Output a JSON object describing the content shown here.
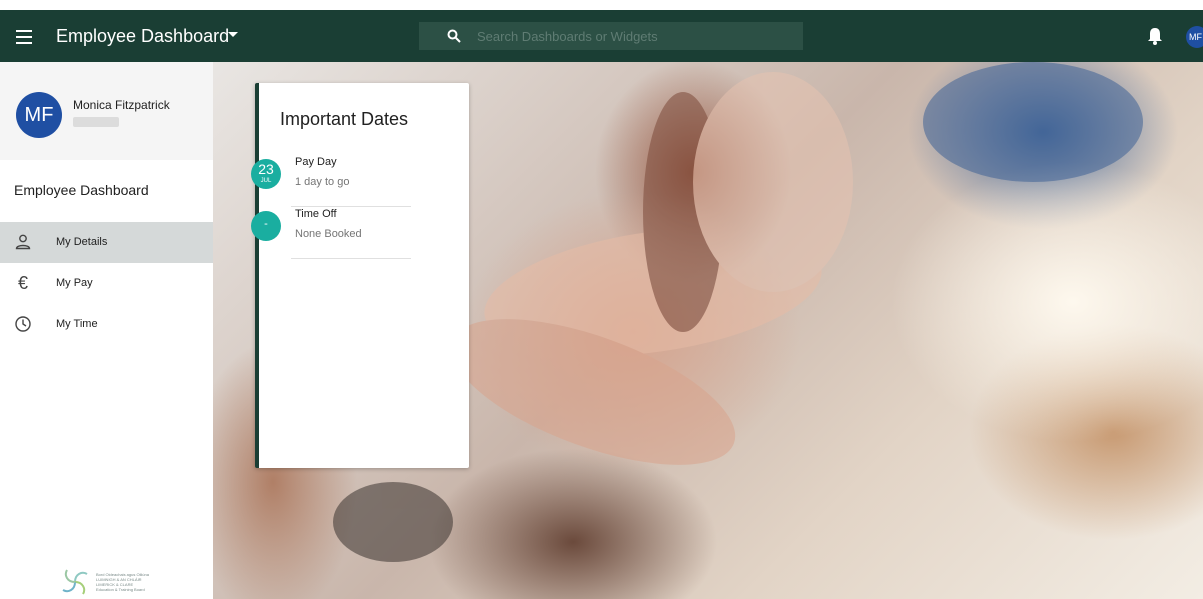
{
  "header": {
    "title": "Employee Dashboard",
    "search_placeholder": "Search Dashboards or Widgets",
    "avatar_initials": "MF"
  },
  "sidebar": {
    "user_name": "Monica Fitzpatrick",
    "avatar_initials": "MF",
    "heading": "Employee Dashboard",
    "items": [
      {
        "label": "My Details",
        "icon": "person-icon",
        "active": true
      },
      {
        "label": "My Pay",
        "icon": "euro-icon",
        "active": false
      },
      {
        "label": "My Time",
        "icon": "clock-icon",
        "active": false
      }
    ],
    "logo_lines": [
      "Bord Oideachais agus Oiliúna",
      "LUIMNIGH & AN CHLÁIR",
      "LIMERICK & CLARE",
      "Education & Training Board"
    ]
  },
  "card": {
    "title": "Important Dates",
    "entries": [
      {
        "day": "23",
        "month": "JUL",
        "label": "Pay Day",
        "sub": "1 day to go"
      },
      {
        "day": "-",
        "month": "",
        "label": "Time Off",
        "sub": "None Booked"
      }
    ]
  },
  "colors": {
    "topbar": "#1a3e34",
    "accent": "#1aaea0",
    "avatar": "#1f4fa3",
    "active_nav": "#d5d9d9"
  }
}
